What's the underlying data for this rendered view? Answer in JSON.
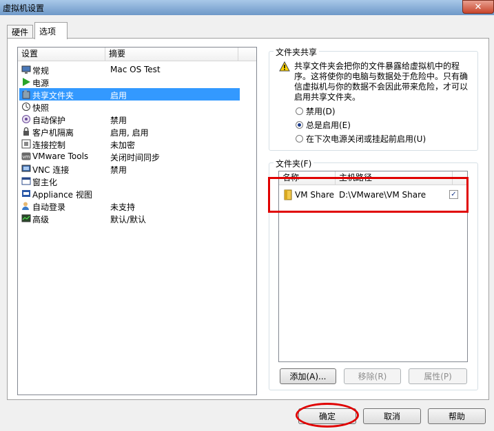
{
  "window": {
    "title": "虚拟机设置",
    "close_glyph": "✕"
  },
  "tabs": [
    {
      "label": "硬件"
    },
    {
      "label": "选项"
    }
  ],
  "settings": {
    "headers": {
      "setting": "设置",
      "summary": "摘要"
    },
    "items": [
      {
        "name": "常规",
        "summary": "Mac OS Test",
        "icon": "monitor-icon"
      },
      {
        "name": "电源",
        "summary": "",
        "icon": "power-play-icon"
      },
      {
        "name": "共享文件夹",
        "summary": "启用",
        "icon": "shared-folder-icon"
      },
      {
        "name": "快照",
        "summary": "",
        "icon": "snapshot-icon"
      },
      {
        "name": "自动保护",
        "summary": "禁用",
        "icon": "autoprotect-icon"
      },
      {
        "name": "客户机隔离",
        "summary": "启用, 启用",
        "icon": "lock-icon"
      },
      {
        "name": "连接控制",
        "summary": "未加密",
        "icon": "access-control-icon"
      },
      {
        "name": "VMware Tools",
        "summary": "关闭时间同步",
        "icon": "vm-icon"
      },
      {
        "name": "VNC 连接",
        "summary": "禁用",
        "icon": "vnc-icon"
      },
      {
        "name": "窗主化",
        "summary": "",
        "icon": "unity-icon"
      },
      {
        "name": "Appliance 视图",
        "summary": "",
        "icon": "appliance-icon"
      },
      {
        "name": "自动登录",
        "summary": "未支持",
        "icon": "user-icon"
      },
      {
        "name": "高级",
        "summary": "默认/默认",
        "icon": "advanced-icon"
      }
    ]
  },
  "sharing": {
    "legend": "文件夹共享",
    "warning": "共享文件夹会把你的文件暴露给虚拟机中的程序。这将使你的电脑与数据处于危险中。只有确信虚拟机与你的数据不会因此带来危险，才可以启用共享文件夹。",
    "options": [
      {
        "label": "禁用(D)",
        "checked": false
      },
      {
        "label": "总是启用(E)",
        "checked": true
      },
      {
        "label": "在下次电源关闭或挂起前启用(U)",
        "checked": false
      }
    ]
  },
  "folders": {
    "legend": "文件夹(F)",
    "headers": {
      "name": "名称",
      "host_path": "主机路径"
    },
    "rows": [
      {
        "name": "VM Share",
        "path": "D:\\VMware\\VM Share",
        "enabled": true
      }
    ],
    "buttons": {
      "add": "添加(A)...",
      "remove": "移除(R)",
      "properties": "属性(P)"
    }
  },
  "footer": {
    "ok": "确定",
    "cancel": "取消",
    "help": "帮助"
  },
  "colors": {
    "selection": "#3399ff",
    "highlight": "#e00000"
  }
}
